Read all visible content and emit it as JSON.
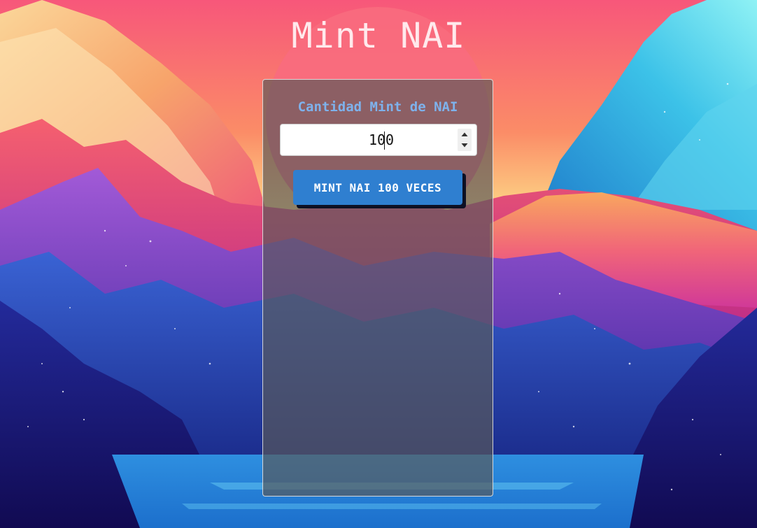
{
  "page": {
    "title": "Mint NAI"
  },
  "mint_form": {
    "label": "Cantidad Mint de NAI",
    "quantity_value": "100",
    "button_label": "MINT NAI 100 VECES"
  },
  "icons": {
    "stepper_up": "triangle-up-icon",
    "stepper_down": "triangle-down-icon"
  },
  "colors": {
    "title": "#ffe9ec",
    "label": "#7eb2ec",
    "button": "#2f7fd0",
    "button_shadow": "#0d1024",
    "card_background": "rgba(88,88,88,0.68)"
  }
}
